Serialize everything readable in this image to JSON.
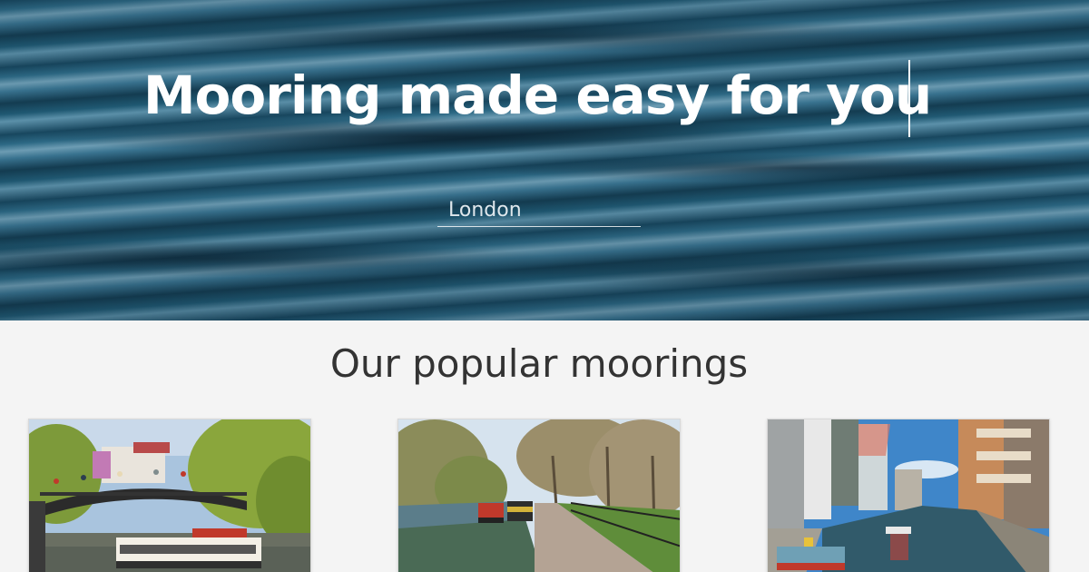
{
  "hero": {
    "title": "Mooring made easy for you",
    "search": {
      "value": "",
      "placeholder": "London"
    }
  },
  "popular": {
    "heading": "Our popular moorings",
    "cards": [
      {
        "image": "camden-lock-bridge-photo"
      },
      {
        "image": "tree-lined-canal-narrowboats-photo"
      },
      {
        "image": "paddington-basin-canal-photo"
      }
    ]
  },
  "colors": {
    "hero_water": "#1f5670",
    "page_background": "#f4f4f4",
    "heading_text": "#333333"
  }
}
